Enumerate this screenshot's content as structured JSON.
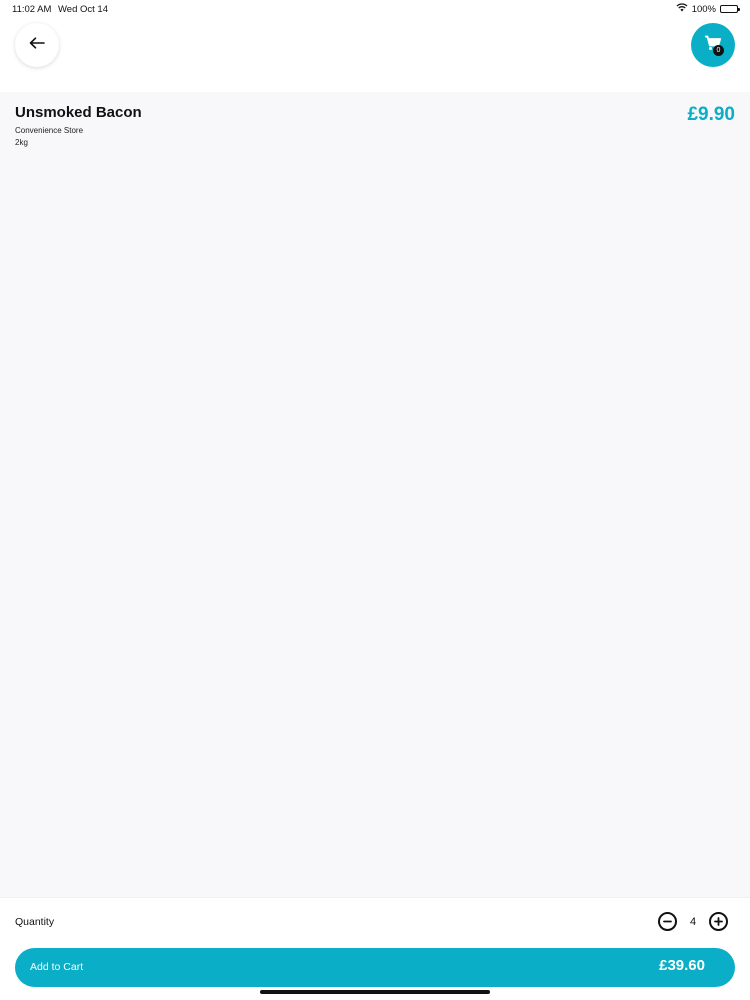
{
  "status_bar": {
    "time": "11:02 AM",
    "date": "Wed Oct 14",
    "battery_percent": "100%",
    "battery_level": 1.0
  },
  "header": {
    "back_icon": "arrow-left-icon",
    "cart_icon": "shopping-cart-icon",
    "cart_count": "0"
  },
  "product": {
    "name": "Unsmoked Bacon",
    "store": "Convenience Store",
    "size": "2kg",
    "price": "£9.90"
  },
  "purchase": {
    "quantity_label": "Quantity",
    "quantity": "4",
    "add_label": "Add to Cart",
    "total": "£39.60"
  },
  "colors": {
    "accent": "#0aaec7",
    "background": "#f8f8fa"
  }
}
